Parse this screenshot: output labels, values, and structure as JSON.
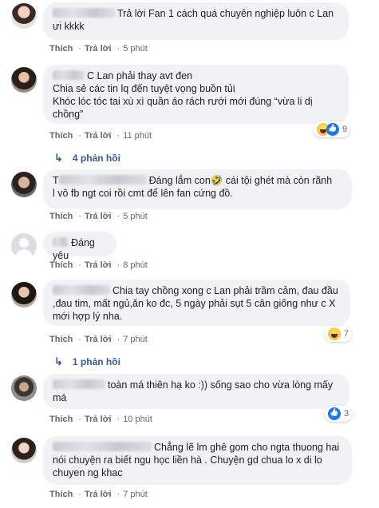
{
  "actions": {
    "like": "Thích",
    "reply": "Trả lời",
    "sep": "·"
  },
  "comments": [
    {
      "text": "Trả lời Fan 1 cách quá chuyên nghiệp luôn c Lan ưi kkkk",
      "time": "5 phút"
    },
    {
      "text_lines": [
        "C Lan phải thay avt đen",
        "Chia sẻ các tin lq đến tuyệt vọng buồn tủi",
        "Khóc lóc tóc tai xù xì quần áo rách rưới mới đúng “vừa li dị",
        "chồng”"
      ],
      "time": "11 phút",
      "reaction_count": "9",
      "replies": "4 phản hồi"
    },
    {
      "text_lines": [
        "Đáng lắm con🤣 cái tội ghét mà còn rãnh",
        "l vô fb ngt coi rồi cmt để lên fan cứng đồ."
      ],
      "prefix": "T",
      "time": "5 phút"
    },
    {
      "text": "Đáng yêu",
      "time": "8 phút"
    },
    {
      "text_lines": [
        "Chia tay chồng xong c Lan phải trầm cảm, đau đầu",
        ",đau tim, mất ngủ,ăn ko đc, 5 ngày phải sụt 5 cân giống như c X",
        "mới hợp lý nha."
      ],
      "time": "7 phút",
      "reaction_count": "7",
      "replies": "1 phản hồi"
    },
    {
      "text_lines": [
        "toàn má thiên hạ ko :)) sống sao cho vừa lòng mấy",
        "má"
      ],
      "time": "10 phút",
      "reaction_count": "3"
    },
    {
      "text_lines": [
        "Chẳng lẽ lm ghê gom cho ngta thuong hai",
        "nói chuyện ra biết ngu học liền hà . Chuyện gd chua lo x di lo",
        "chuyen ng khac"
      ],
      "time": "7 phút"
    }
  ]
}
